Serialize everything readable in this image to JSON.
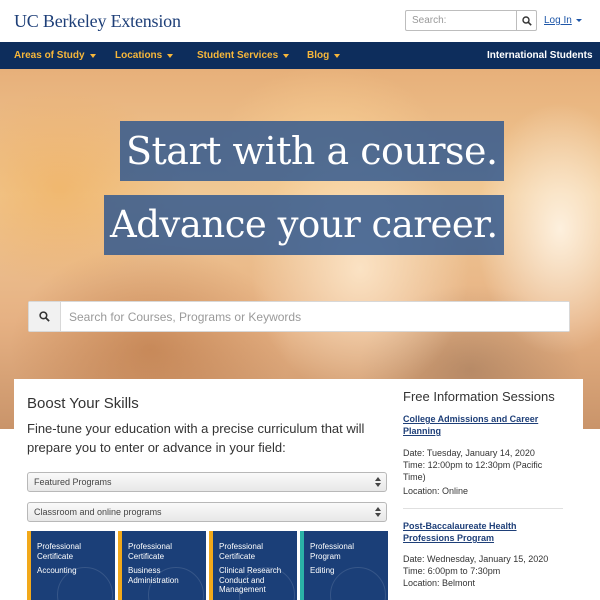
{
  "header": {
    "logo": "UC Berkeley Extension",
    "search_placeholder": "Search:",
    "login_label": "Log In"
  },
  "nav": {
    "items": [
      {
        "label": "Areas of Study"
      },
      {
        "label": "Locations"
      },
      {
        "label": "Student Services"
      },
      {
        "label": "Blog"
      }
    ],
    "right_link": "International Students"
  },
  "hero": {
    "headline_1": "Start with a course.",
    "headline_2": "Advance your career.",
    "search_placeholder": "Search for Courses, Programs or Keywords"
  },
  "boost": {
    "title": "Boost Your Skills",
    "description": "Fine-tune your education with a precise curriculum that will prepare you to enter or advance in your field:",
    "select_1": "Featured Programs",
    "select_2": "Classroom and online programs",
    "cards": [
      {
        "kind": "Professional Certificate",
        "name": "Accounting",
        "stripe_color": "#f2a91a"
      },
      {
        "kind": "Professional Certificate",
        "name": "Business Administration",
        "stripe_color": "#f2a91a"
      },
      {
        "kind": "Professional Certificate",
        "name": "Clinical Research Conduct and Management",
        "stripe_color": "#f2a91a"
      },
      {
        "kind": "Professional Program",
        "name": "Editing",
        "stripe_color": "#2bb3a7"
      }
    ]
  },
  "info_sessions": {
    "title": "Free Information Sessions",
    "sessions": [
      {
        "title": "College Admissions and Career Planning",
        "date": "Date: Tuesday, January 14, 2020",
        "time": "Time: 12:00pm to 12:30pm (Pacific Time)",
        "location": "Location: Online"
      },
      {
        "title": "Post-Baccalaureate Health Professions Program",
        "date": "Date: Wednesday, January 15, 2020",
        "time": "Time: 6:00pm to 7:30pm",
        "location": "Location: Belmont"
      }
    ]
  },
  "colors": {
    "brand_navy": "#0d2d5c",
    "nav_gold": "#f7b73a",
    "link_blue": "#1e3f78",
    "card_blue": "#1b3f78"
  },
  "icons": {
    "header_search": "search-icon",
    "hero_search": "search-icon",
    "login_caret": "caret-down-icon",
    "nav_caret": "caret-down-icon",
    "select_arrows": "select-arrows-icon"
  }
}
